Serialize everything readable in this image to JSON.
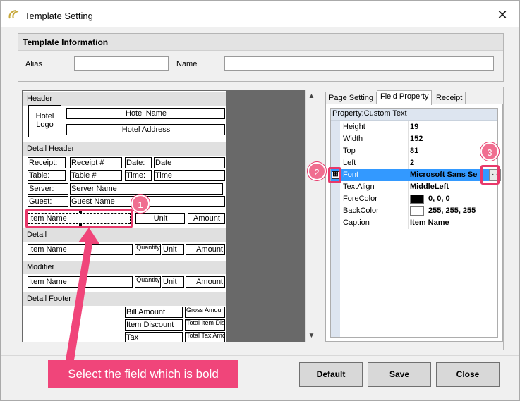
{
  "window": {
    "title": "Template Setting"
  },
  "info": {
    "section_title": "Template Information",
    "alias_label": "Alias",
    "alias_value": "",
    "name_label": "Name",
    "name_value": ""
  },
  "designer": {
    "sections": {
      "header": "Header",
      "detail_header": "Detail Header",
      "detail": "Detail",
      "modifier": "Modifier",
      "detail_footer": "Detail Footer"
    },
    "header": {
      "logo_line1": "Hotel",
      "logo_line2": "Logo",
      "hotel_name": "Hotel Name",
      "hotel_address": "Hotel Address"
    },
    "detail_header": {
      "receipt_label": "Receipt:",
      "receipt_value": "Receipt #",
      "date_label": "Date:",
      "date_value": "Date",
      "table_label": "Table:",
      "table_value": "Table #",
      "time_label": "Time:",
      "time_value": "Time",
      "server_label": "Server:",
      "server_value": "Server Name",
      "guest_label": "Guest:",
      "guest_value": "Guest Name",
      "item_name": "Item Name",
      "unit": "Unit",
      "amount": "Amount"
    },
    "detail": {
      "item_name": "Item Name",
      "quantity": "Quantity",
      "unit": "Unit",
      "amount": "Amount"
    },
    "modifier": {
      "item_name": "Item Name",
      "quantity": "Quantity",
      "unit": "Unit",
      "amount": "Amount"
    },
    "footer": {
      "bill_amount": "Bill Amount",
      "gross_amount": "Gross Amount",
      "item_discount": "Item Discount",
      "total_item_discount": "Total Item Discount",
      "tax": "Tax",
      "total_tax_amount": "Total Tax Amount"
    }
  },
  "tabs": [
    "Page Setting",
    "Field Property",
    "Receipt"
  ],
  "property_grid": {
    "header": "Property:Custom Text",
    "rows": [
      {
        "name": "Height",
        "value": "19"
      },
      {
        "name": "Width",
        "value": "152"
      },
      {
        "name": "Top",
        "value": "81"
      },
      {
        "name": "Left",
        "value": "2"
      },
      {
        "name": "Font",
        "value": "Microsoft Sans Se"
      },
      {
        "name": "TextAlign",
        "value": "MiddleLeft"
      },
      {
        "name": "ForeColor",
        "value": "0, 0, 0",
        "color": "#000000"
      },
      {
        "name": "BackColor",
        "value": "255, 255, 255",
        "color": "#ffffff"
      },
      {
        "name": "Caption",
        "value": "Item Name"
      }
    ],
    "expander_symbol": "⊞",
    "ellipsis_label": "..."
  },
  "buttons": {
    "default": "Default",
    "save": "Save",
    "close": "Close"
  },
  "annotations": {
    "badge1": "1",
    "badge2": "2",
    "badge3": "3",
    "callout": "Select the field which is bold",
    "accent_color": "#e8386a"
  },
  "icons": {
    "app": "app-logo-icon",
    "close": "close-icon",
    "scroll_up": "scroll-up-icon",
    "scroll_down": "scroll-down-icon"
  }
}
